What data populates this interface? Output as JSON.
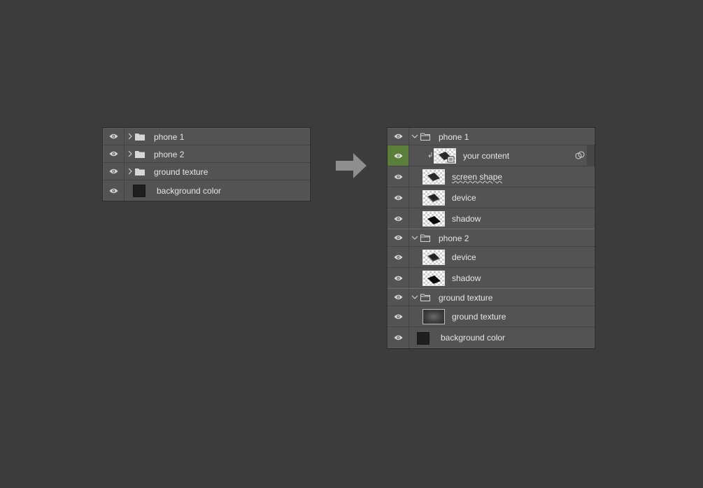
{
  "left_panel": {
    "rows": [
      {
        "label": "phone 1"
      },
      {
        "label": "phone 2"
      },
      {
        "label": "ground texture"
      },
      {
        "label": "background color"
      }
    ]
  },
  "right_panel": {
    "rows": [
      {
        "label": "phone 1"
      },
      {
        "label": "your content"
      },
      {
        "label": "screen shape"
      },
      {
        "label": "device"
      },
      {
        "label": "shadow"
      },
      {
        "label": "phone 2"
      },
      {
        "label": "device"
      },
      {
        "label": "shadow"
      },
      {
        "label": "ground texture"
      },
      {
        "label": "ground texture"
      },
      {
        "label": "background color"
      }
    ]
  },
  "icons": {
    "visibility": "eye-icon",
    "collapsed": "chevron-right-icon",
    "expanded": "chevron-down-icon",
    "group": "folder-icon",
    "clipping": "clipping-mask-arrow-icon",
    "smart_object": "smart-object-icon",
    "link": "link-icon",
    "transition": "arrow-right-icon"
  },
  "colors": {
    "background": "#3c3c3c",
    "panel": "#535353",
    "selected_eye": "#5b7e3a",
    "text": "#e6e6e6"
  }
}
